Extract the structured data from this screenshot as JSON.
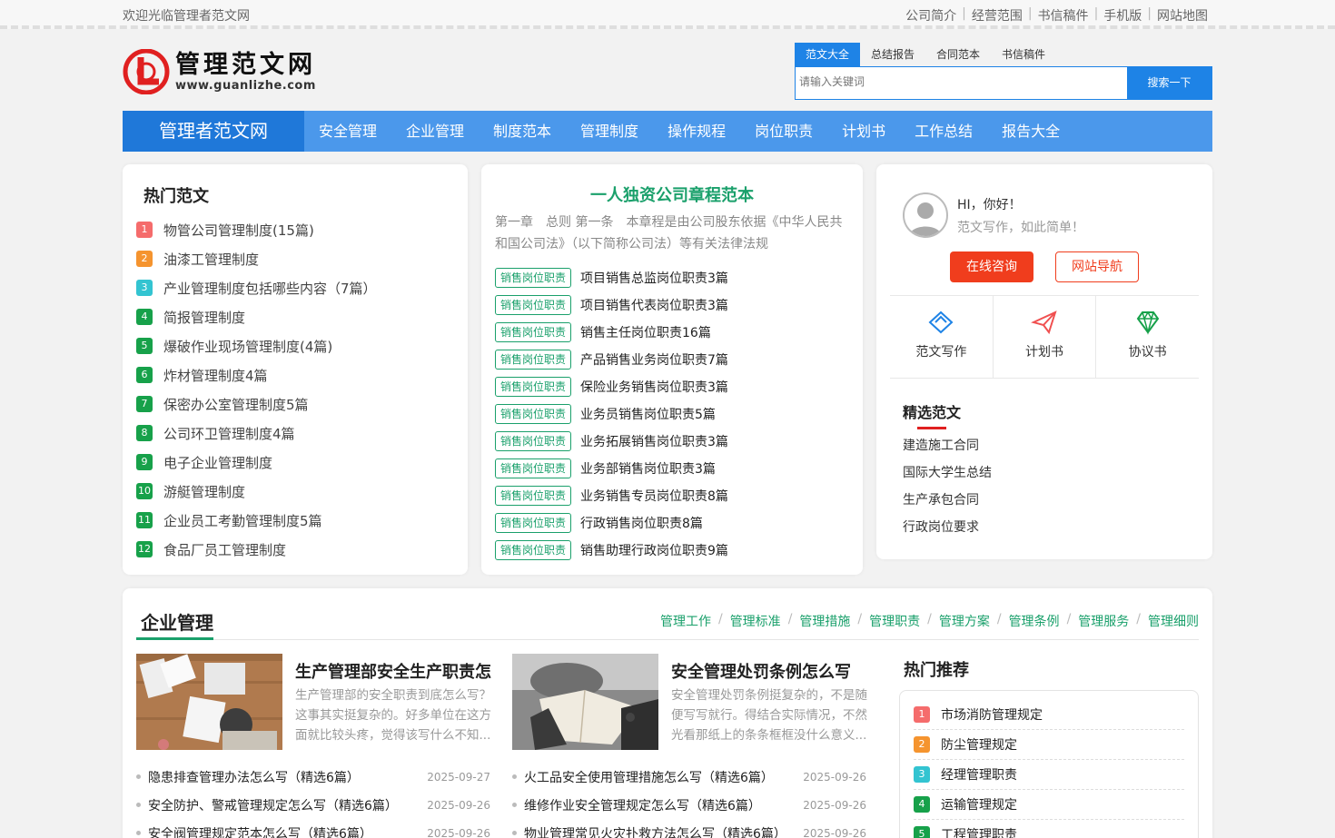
{
  "topbar": {
    "welcome": "欢迎光临管理者范文网",
    "links": [
      "公司简介",
      "经营范围",
      "书信稿件",
      "手机版",
      "网站地图"
    ]
  },
  "logo": {
    "title": "管理范文网",
    "url": "www.guanlizhe.com"
  },
  "search": {
    "tabs": [
      "范文大全",
      "总结报告",
      "合同范本",
      "书信稿件"
    ],
    "active_tab": 0,
    "placeholder": "请输入关键词",
    "button": "搜索一下"
  },
  "nav": {
    "brand": "管理者范文网",
    "items": [
      "安全管理",
      "企业管理",
      "制度范本",
      "管理制度",
      "操作规程",
      "岗位职责",
      "计划书",
      "工作总结",
      "报告大全"
    ]
  },
  "hot": {
    "title": "热门范文",
    "items": [
      {
        "n": "1",
        "text": "物管公司管理制度(15篇)"
      },
      {
        "n": "2",
        "text": "油漆工管理制度"
      },
      {
        "n": "3",
        "text": "产业管理制度包括哪些内容（7篇）"
      },
      {
        "n": "4",
        "text": "简报管理制度"
      },
      {
        "n": "5",
        "text": "爆破作业现场管理制度(4篇)"
      },
      {
        "n": "6",
        "text": "炸材管理制度4篇"
      },
      {
        "n": "7",
        "text": "保密办公室管理制度5篇"
      },
      {
        "n": "8",
        "text": "公司环卫管理制度4篇"
      },
      {
        "n": "9",
        "text": "电子企业管理制度"
      },
      {
        "n": "10",
        "text": "游艇管理制度"
      },
      {
        "n": "11",
        "text": "企业员工考勤管理制度5篇"
      },
      {
        "n": "12",
        "text": "食品厂员工管理制度"
      }
    ]
  },
  "feature": {
    "title": "一人独资公司章程范本",
    "intro": "第一章　总则 第一条　本章程是由公司股东依据《中华人民共和国公司法》（以下简称公司法）等有关法律法规",
    "tag": "销售岗位职责",
    "items": [
      "项目销售总监岗位职责3篇",
      "项目销售代表岗位职责3篇",
      "销售主任岗位职责16篇",
      "产品销售业务岗位职责7篇",
      "保险业务销售岗位职责3篇",
      "业务员销售岗位职责5篇",
      "业务拓展销售岗位职责3篇",
      "业务部销售岗位职责3篇",
      "业务销售专员岗位职责8篇",
      "行政销售岗位职责8篇",
      "销售助理行政岗位职责9篇"
    ]
  },
  "user": {
    "greeting": "HI，你好！",
    "subtitle": "范文写作，如此简单！",
    "consult_btn": "在线咨询",
    "nav_btn": "网站导航",
    "quick": [
      {
        "label": "范文写作",
        "icon": "pen-diamond-icon"
      },
      {
        "label": "计划书",
        "icon": "paper-plane-icon"
      },
      {
        "label": "协议书",
        "icon": "diamond-icon"
      }
    ],
    "picks_title": "精选范文",
    "picks": [
      "建造施工合同",
      "国际大学生总结",
      "生产承包合同",
      "行政岗位要求"
    ]
  },
  "section": {
    "title": "企业管理",
    "links": [
      "管理工作",
      "管理标准",
      "管理措施",
      "管理职责",
      "管理方案",
      "管理条例",
      "管理服务",
      "管理细则"
    ],
    "articles": [
      {
        "title": "生产管理部安全生产职责怎",
        "summary": "生产管理部的安全职责到底怎么写？这事其实挺复杂的。好多单位在这方面就比较头疼，觉得该写什么不知..."
      },
      {
        "title": "安全管理处罚条例怎么写",
        "summary": "安全管理处罚条例挺复杂的，不是随便写写就行。得结合实际情况，不然光看那纸上的条条框框没什么意义..."
      }
    ],
    "list_left": [
      {
        "text": "隐患排查管理办法怎么写（精选6篇）",
        "date": "2025-09-27"
      },
      {
        "text": "安全防护、警戒管理规定怎么写（精选6篇）",
        "date": "2025-09-26"
      },
      {
        "text": "安全阀管理规定范本怎么写（精选6篇）",
        "date": "2025-09-26"
      }
    ],
    "list_right": [
      {
        "text": "火工品安全使用管理措施怎么写（精选6篇）",
        "date": "2025-09-26"
      },
      {
        "text": "维修作业安全管理规定怎么写（精选6篇）",
        "date": "2025-09-26"
      },
      {
        "text": "物业管理常见火灾扑救方法怎么写（精选6篇）",
        "date": "2025-09-26"
      }
    ],
    "rec_title": "热门推荐",
    "rec": [
      {
        "n": "1",
        "text": "市场消防管理规定"
      },
      {
        "n": "2",
        "text": "防尘管理规定"
      },
      {
        "n": "3",
        "text": "经理管理职责"
      },
      {
        "n": "4",
        "text": "运输管理规定"
      },
      {
        "n": "5",
        "text": "工程管理职责"
      }
    ]
  },
  "colors": {
    "primary": "#1e83e6",
    "nav": "#4b98eb",
    "green": "#1aa06b",
    "red": "#f03d1d"
  }
}
